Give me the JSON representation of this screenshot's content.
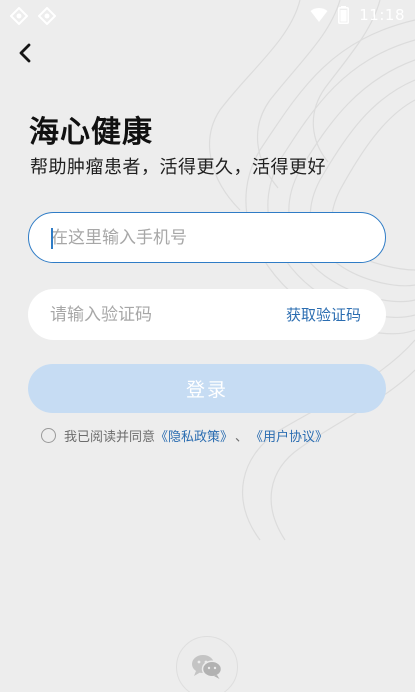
{
  "status_bar": {
    "time": "11:18",
    "icons": [
      "app-notification-icon",
      "app-notification-icon",
      "wifi-icon",
      "battery-icon"
    ]
  },
  "nav": {
    "back_icon": "chevron-left-icon"
  },
  "header": {
    "title": "海心健康",
    "subtitle": "帮助肿瘤患者，活得更久，活得更好"
  },
  "form": {
    "phone_placeholder": "在这里输入手机号",
    "phone_value": "",
    "code_placeholder": "请输入验证码",
    "code_value": "",
    "get_code_label": "获取验证码",
    "login_label": "登录"
  },
  "agreement": {
    "checked": false,
    "prefix": "我已阅读并同意",
    "privacy_link": "《隐私政策》",
    "separator": "、",
    "user_link": "《用户协议》"
  },
  "social_login": {
    "icon": "wechat-icon"
  },
  "colors": {
    "accent": "#2f7cc6",
    "link": "#2b6db1",
    "button_disabled": "#c6dcf3",
    "background": "#ededed"
  }
}
